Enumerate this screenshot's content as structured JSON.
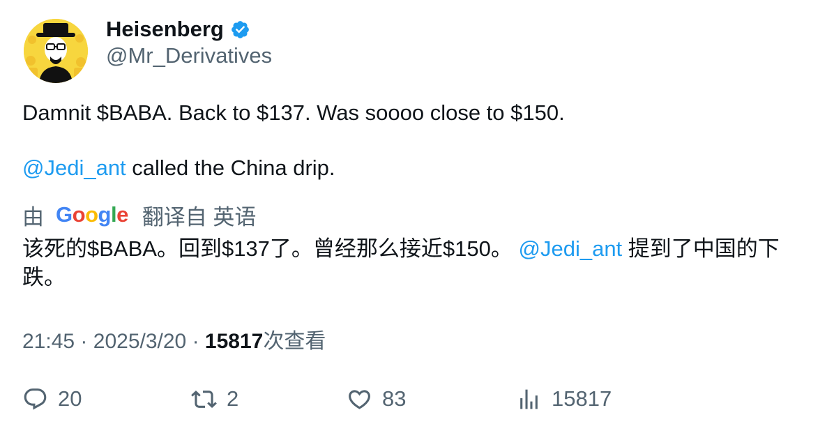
{
  "author": {
    "display_name": "Heisenberg",
    "handle": "@Mr_Derivatives",
    "verified": true,
    "avatar_icon": "heisenberg-avatar-icon"
  },
  "tweet": {
    "line1": "Damnit $BABA. Back to $137. Was soooo close to $150.",
    "mention": "@Jedi_ant",
    "line2_rest": " called the China drip."
  },
  "translation": {
    "prefix": "由",
    "provider": "Google",
    "suffix": "翻译自 英语",
    "text_before": "该死的$BABA。回到$137了。曾经那么接近$150。 ",
    "mention": "@Jedi_ant",
    "text_after": " 提到了中国的下跌。"
  },
  "meta": {
    "time": "21:45",
    "separator": "·",
    "date": "2025/3/20",
    "views": "15817",
    "views_label": "次查看"
  },
  "actions": {
    "replies": "20",
    "retweets": "2",
    "likes": "83",
    "views": "15817"
  },
  "colors": {
    "link": "#1d9bf0",
    "secondary_text": "#536471",
    "primary_text": "#0f1419",
    "google_blue": "#4285F4",
    "google_red": "#EA4335",
    "google_yellow": "#FBBC05",
    "google_green": "#34A853"
  }
}
